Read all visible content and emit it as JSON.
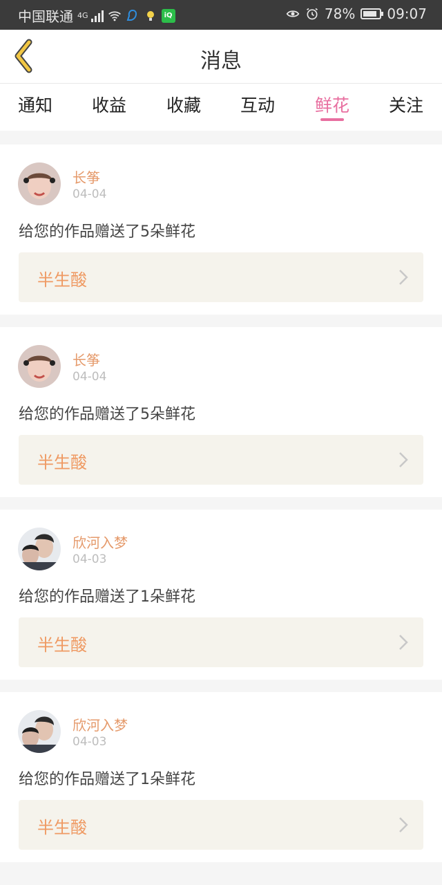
{
  "status_bar": {
    "carrier": "中国联通",
    "network": "4G",
    "battery": "78%",
    "time": "09:07"
  },
  "header": {
    "title": "消息"
  },
  "tabs": [
    {
      "label": "通知"
    },
    {
      "label": "收益"
    },
    {
      "label": "收藏"
    },
    {
      "label": "互动"
    },
    {
      "label": "鲜花",
      "active": true
    },
    {
      "label": "关注"
    }
  ],
  "notifications": [
    {
      "user": "长筝",
      "date": "04-04",
      "message": "给您的作品赠送了5朵鲜花",
      "work": "半生酸"
    },
    {
      "user": "长筝",
      "date": "04-04",
      "message": "给您的作品赠送了5朵鲜花",
      "work": "半生酸"
    },
    {
      "user": "欣河入梦",
      "date": "04-03",
      "message": "给您的作品赠送了1朵鲜花",
      "work": "半生酸"
    },
    {
      "user": "欣河入梦",
      "date": "04-03",
      "message": "给您的作品赠送了1朵鲜花",
      "work": "半生酸"
    }
  ],
  "colors": {
    "accent_pink": "#e86fa0",
    "username_orange": "#e59a6b",
    "work_title_orange": "#ef9a63",
    "back_arrow": "#f2c744"
  },
  "icons": [
    "back-arrow-icon",
    "chevron-right-icon",
    "wifi-icon",
    "signal-icon",
    "eye-icon",
    "alarm-icon",
    "battery-icon"
  ]
}
